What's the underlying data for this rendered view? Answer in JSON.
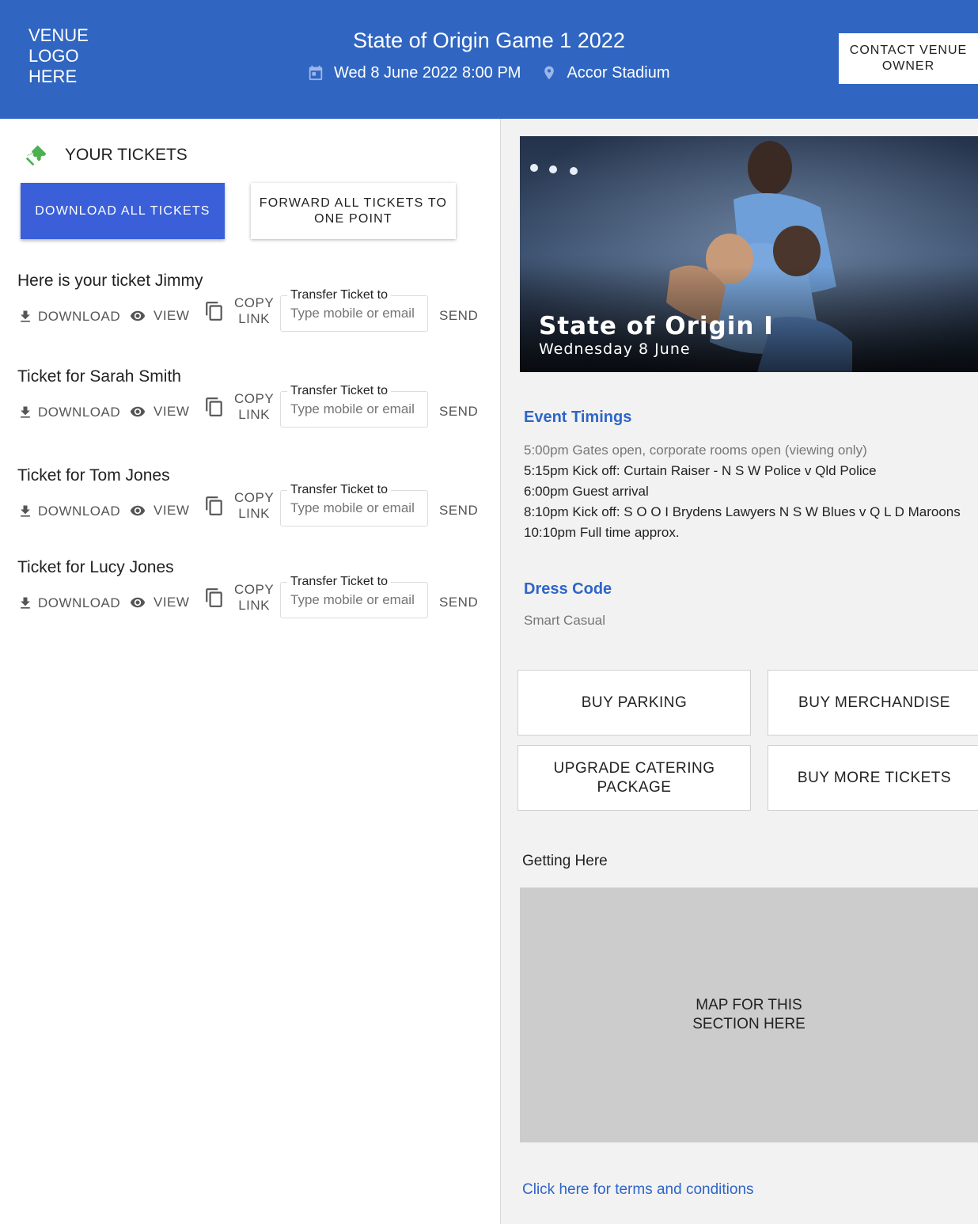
{
  "header": {
    "logo_text": "VENUE LOGO HERE",
    "event_title": "State of Origin Game 1 2022",
    "date_time": "Wed 8 June 2022 8:00 PM",
    "venue": "Accor Stadium",
    "contact_button": "CONTACT VENUE OWNER",
    "background_color": "#3066c1"
  },
  "tickets_panel": {
    "heading": "YOUR TICKETS",
    "download_all_label": "DOWNLOAD ALL TICKETS",
    "forward_all_label": "FORWARD ALL TICKETS TO ONE POINT",
    "action_labels": {
      "download": "DOWNLOAD",
      "view": "VIEW",
      "copy": "COPY",
      "link": "LINK",
      "transfer_label": "Transfer Ticket to",
      "transfer_placeholder": "Type mobile or email",
      "send": "SEND"
    },
    "tickets": [
      {
        "title": "Here is your ticket Jimmy"
      },
      {
        "title": "Ticket for Sarah Smith"
      },
      {
        "title": "Ticket for Tom Jones"
      },
      {
        "title": "Ticket for Lucy Jones"
      }
    ]
  },
  "event_panel": {
    "hero_title": "State of Origin I",
    "hero_subtitle": "Wednesday 8 June",
    "timings_heading": "Event Timings",
    "timings": [
      "5:00pm Gates open, corporate rooms open (viewing only)",
      "5:15pm Kick off: Curtain Raiser - N S W Police v Qld Police",
      "6:00pm Guest arrival",
      "8:10pm Kick off: S O O I Brydens Lawyers N S W Blues v Q L D Maroons",
      "10:10pm Full time approx."
    ],
    "dress_code_heading": "Dress Code",
    "dress_code": "Smart Casual",
    "buttons": {
      "buy_parking": "BUY PARKING",
      "buy_merchandise": "BUY MERCHANDISE",
      "upgrade_catering": "UPGRADE CATERING PACKAGE",
      "buy_more_tickets": "BUY MORE TICKETS"
    },
    "getting_here": "Getting Here",
    "map_placeholder": "MAP FOR THIS SECTION HERE",
    "terms_link": "Click here for terms and conditions"
  }
}
